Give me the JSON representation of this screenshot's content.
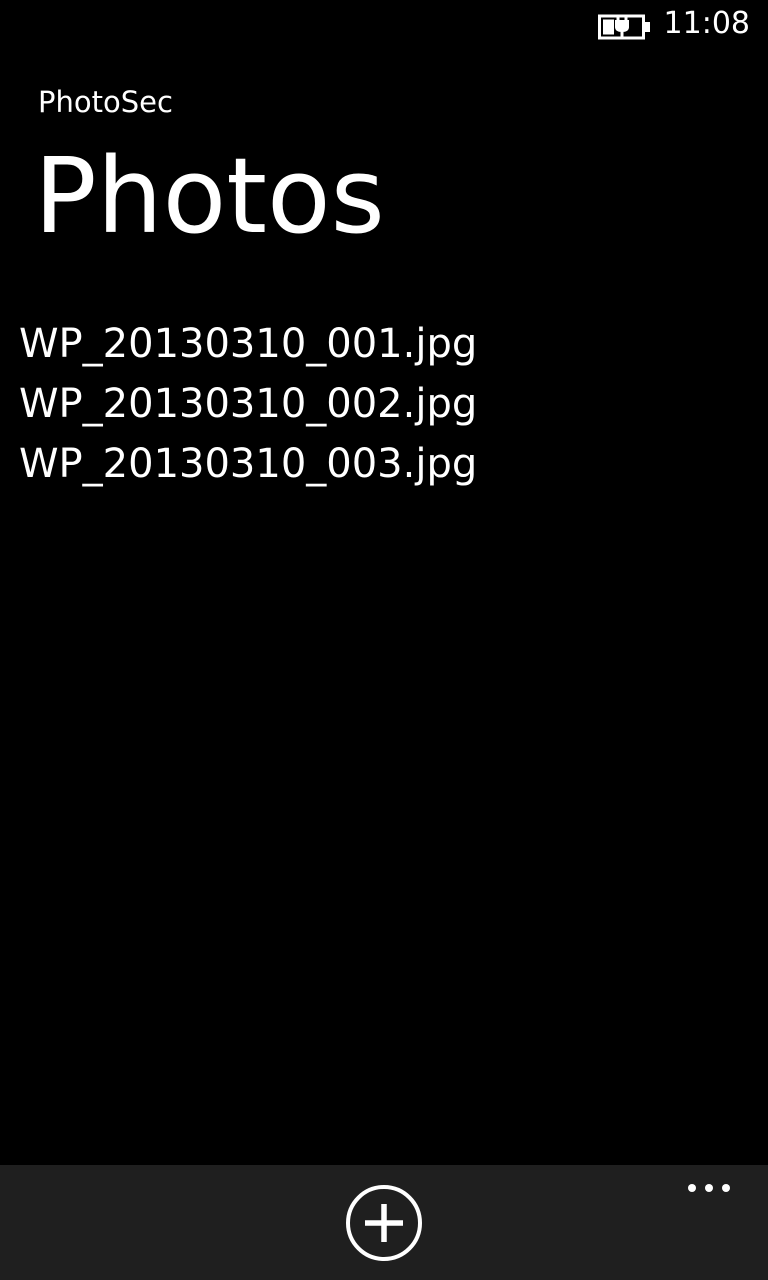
{
  "status_bar": {
    "time": "11:08",
    "battery_icon": "battery-charging-icon"
  },
  "header": {
    "app_title": "PhotoSec",
    "page_title": "Photos"
  },
  "photos": [
    {
      "filename": "WP_20130310_001.jpg"
    },
    {
      "filename": "WP_20130310_002.jpg"
    },
    {
      "filename": "WP_20130310_003.jpg"
    }
  ],
  "app_bar": {
    "add_icon": "add-circle-icon",
    "more_icon": "ellipsis-icon",
    "background_color": "#1f1f1f"
  }
}
